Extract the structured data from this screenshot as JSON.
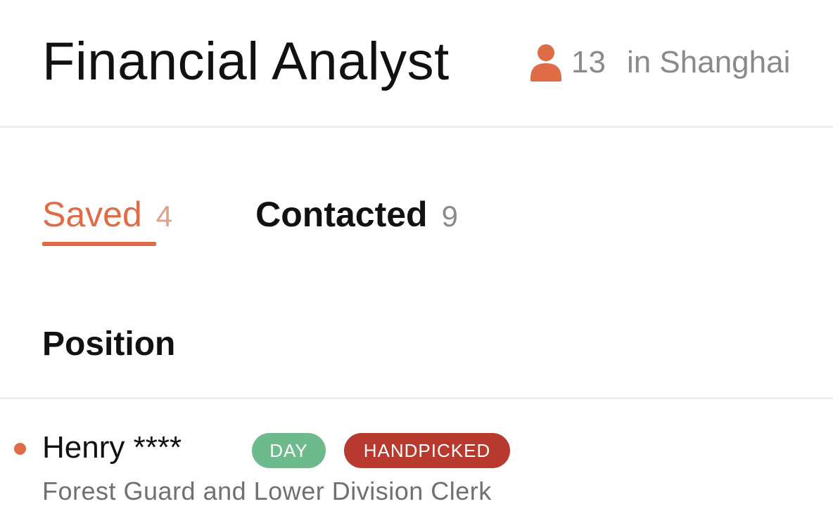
{
  "header": {
    "job_title": "Financial Analyst",
    "person_icon": "person-icon",
    "applicant_count": "13",
    "location": "in Shanghai"
  },
  "tabs": [
    {
      "label": "Saved",
      "count": "4",
      "active": true
    },
    {
      "label": "Contacted",
      "count": "9",
      "active": false
    }
  ],
  "section": {
    "title": "Position"
  },
  "candidates": [
    {
      "name": "Henry ****",
      "badges": [
        "DAY",
        "HANDPICKED"
      ],
      "subtitle": "Forest Guard and Lower Division Clerk",
      "unread": true
    }
  ],
  "colors": {
    "accent": "#de6c46",
    "badge_day": "#6dbb8c",
    "badge_handpicked": "#b83a2f",
    "muted_text": "#8a8a8a"
  }
}
